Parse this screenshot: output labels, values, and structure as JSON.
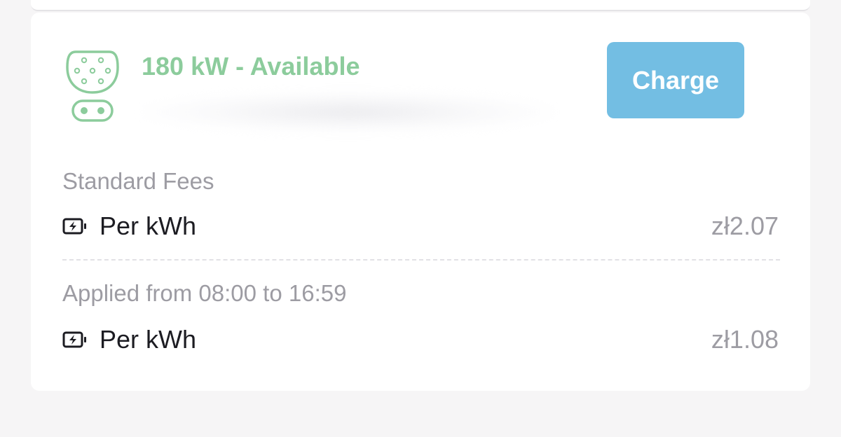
{
  "station": {
    "title": "180 kW - Available",
    "connector_icon": "ccs-connector-icon",
    "status_color": "#8ccc9c",
    "charge_label": "Charge",
    "accent_color": "#73bee3"
  },
  "fees": {
    "standard": {
      "label": "Standard Fees",
      "name": "Per kWh",
      "price": "zł2.07",
      "icon": "charging-battery-icon"
    },
    "timed": {
      "label": "Applied from 08:00 to 16:59",
      "name": "Per kWh",
      "price": "zł1.08",
      "icon": "charging-battery-icon"
    }
  }
}
